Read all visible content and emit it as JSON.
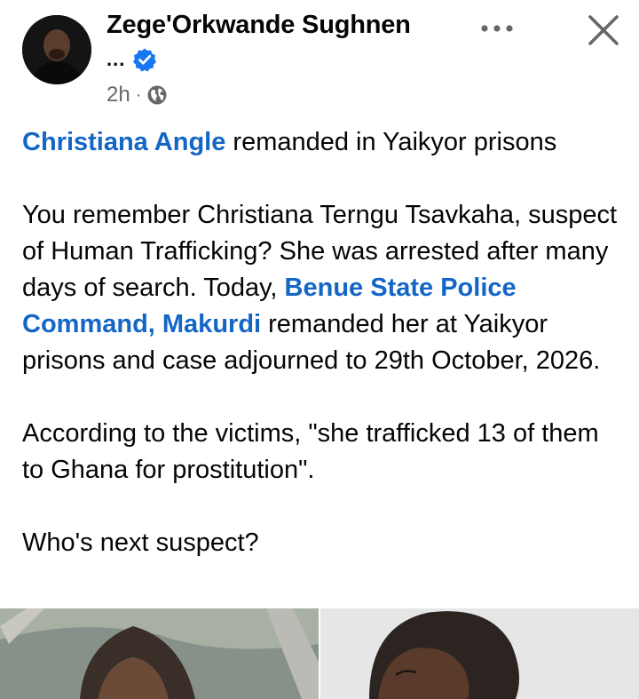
{
  "post": {
    "author_name": "Zege'Orkwande Sughnen",
    "author_subtitle": "...",
    "verified": true,
    "time": "2h",
    "visibility_icon": "globe-icon",
    "more_icon": "more-options-icon",
    "close_icon": "close-icon",
    "headline": {
      "mention": "Christiana Angle",
      "rest": " remanded in Yaikyor prisons"
    },
    "paragraph1": {
      "before": "You remember Christiana Terngu Tsavkaha, suspect of Human Trafficking? She was arrested after many days of search. Today, ",
      "mention": "Benue State Police Command, Makurdi",
      "after": " remanded her at Yaikyor prisons and case adjourned to 29th October, 2026."
    },
    "paragraph2": "According to the victims, \"she trafficked 13 of them to Ghana for prostitution\".",
    "paragraph3": "Who's next suspect?"
  },
  "colors": {
    "mention": "#1466c6",
    "verified_badge": "#1877f2",
    "meta_text": "#65676b"
  }
}
